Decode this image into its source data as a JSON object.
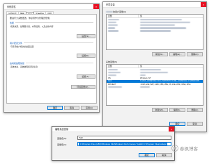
{
  "system_properties": {
    "title": "系统属性",
    "tabs": [
      "计算机名",
      "硬件",
      "高级",
      "系统保护",
      "远程"
    ],
    "active_tab_index": 2,
    "note": "要进行大多数更改，你必须作为管理员登录。",
    "groups": [
      {
        "title": "性能",
        "desc": "视觉效果，处理器计划，内存使用，以及虚拟内存",
        "button": "设置(S)..."
      },
      {
        "title": "用户配置文件",
        "desc": "与登录帐户相关的桌面设置",
        "button": "设置(E)..."
      },
      {
        "title": "启动和故障恢复",
        "desc": "系统启动、系统故障和调试信息",
        "button": "设置(T)..."
      }
    ],
    "env_button": "环境变量(N)...",
    "buttons": {
      "ok": "确定",
      "cancel": "取消",
      "apply": "应用(A)"
    }
  },
  "env_vars": {
    "title": "环境变量",
    "user_section_label": "的用户变量(U)",
    "system_section_label": "系统变量(S)",
    "col_variable": "变量",
    "col_value": "值",
    "user_buttons": [
      "新建(N)...",
      "编辑(E)...",
      "删除(D)"
    ],
    "system_vars": [
      {
        "name": "OS",
        "value": "Windows_NT"
      },
      {
        "name": "Path",
        "value": "%JAVA_HOME%\\bin;%CLASSPATH%;%JRE_HOME%\\bin;C:\\WINDOWS..."
      },
      {
        "name": "PATHEXT",
        "value": ".COM;.EXE;.BAT;.CMD;.VBS;.VBE;.JS;.JSE;.WSF;.WSH;.MSC"
      }
    ],
    "selected_index": 3,
    "system_buttons": [
      "新建(W)...",
      "编辑(I)...",
      "删除(L)"
    ],
    "buttons": {
      "ok": "确定",
      "cancel": "取消"
    }
  },
  "edit_dialog": {
    "title": "编辑系统变量",
    "name_label": "变量名(N):",
    "name_value": "Path",
    "value_label": "变量值(V):",
    "value_value": ";C:\\Program Files (x86)\\Windows Kits\\Windows Performance Toolkit\\;C:\\Program Files\\nodejs\\",
    "buttons": {
      "ok": "确定",
      "cancel": "取消"
    }
  },
  "watermark": {
    "text": "春枫博客"
  }
}
